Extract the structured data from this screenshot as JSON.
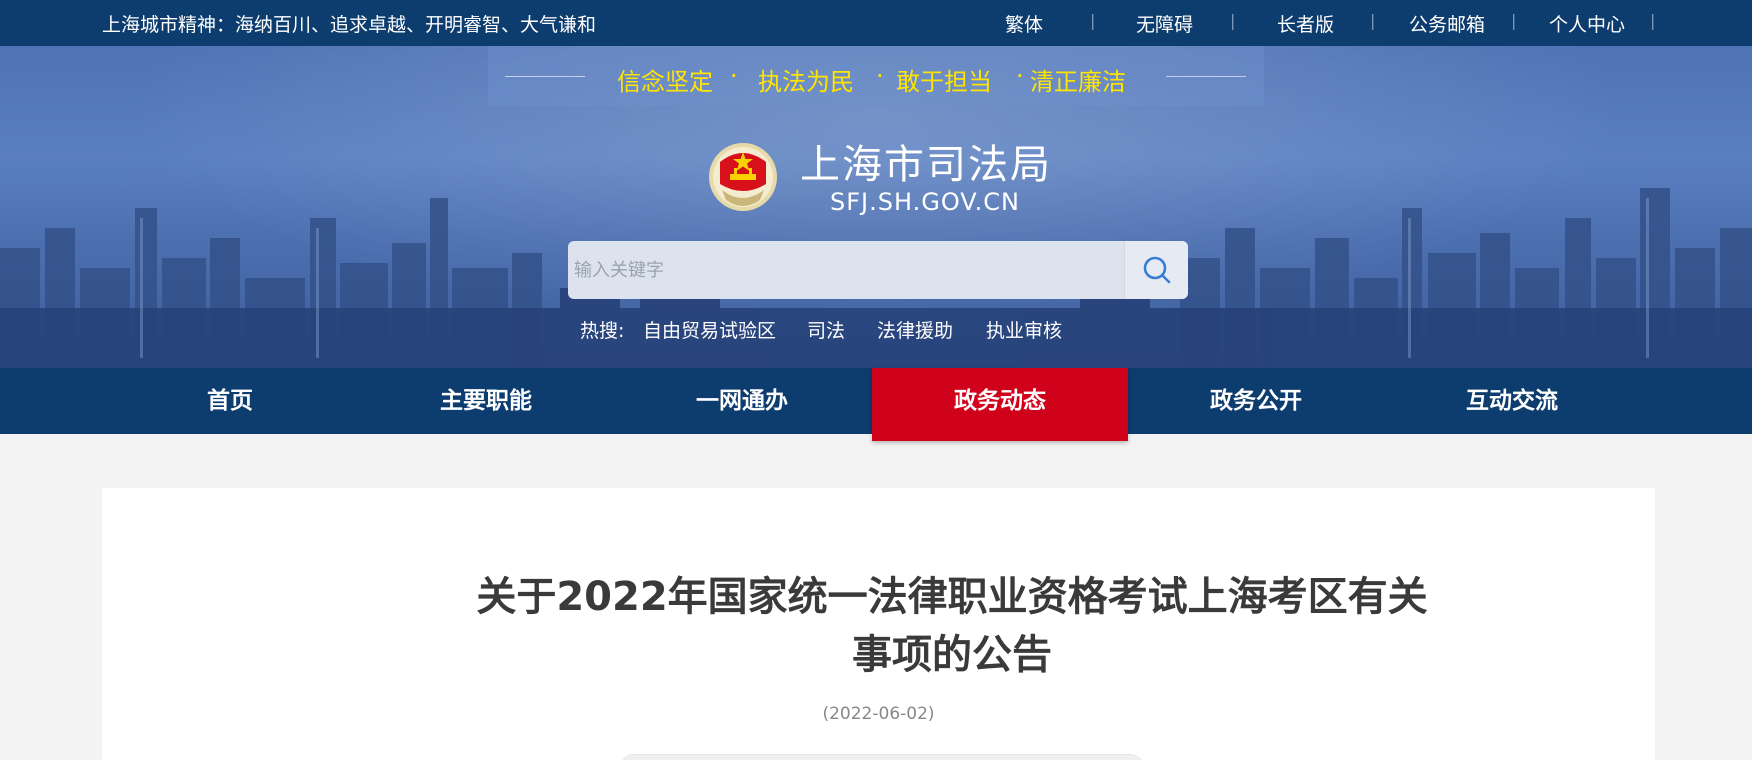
{
  "topbar": {
    "spirit": "上海城市精神：海纳百川、追求卓越、开明睿智、大气谦和",
    "links": [
      "繁体",
      "无障碍",
      "长者版",
      "公务邮箱",
      "个人中心"
    ]
  },
  "banner": {
    "slogans": [
      "信念坚定",
      "执法为民",
      "敢于担当",
      "清正廉洁"
    ],
    "site_name": "上海市司法局",
    "site_domain": "SFJ.SH.GOV.CN",
    "search": {
      "placeholder": "输入关键字"
    },
    "hot_label": "热搜:",
    "hot_items": [
      "自由贸易试验区",
      "司法",
      "法律援助",
      "执业审核"
    ]
  },
  "nav": {
    "items": [
      "首页",
      "主要职能",
      "一网通办",
      "政务动态",
      "政务公开",
      "互动交流"
    ],
    "active": "政务动态"
  },
  "article": {
    "title_line1": "关于2022年国家统一法律职业资格考试上海考区有关",
    "title_line2": "事项的公告",
    "date": "(2022-06-02)"
  },
  "colors": {
    "navy": "#0d3c6e",
    "active_red": "#d0021b",
    "slogan_yellow": "#ffe400"
  }
}
